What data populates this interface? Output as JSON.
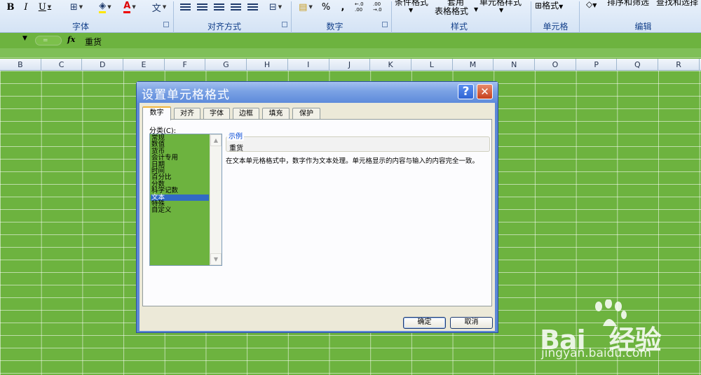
{
  "ribbon": {
    "groups": [
      "字体",
      "对齐方式",
      "数字",
      "样式",
      "单元格",
      "编辑"
    ],
    "text": {
      "cond_fmt": "条件格式",
      "table_fmt_top": "套用",
      "table_fmt": "表格格式",
      "cell_style": "单元格样式",
      "format": "格式",
      "sort": "排序和筛选",
      "find": "查找和选择"
    },
    "symbols": {
      "bold": "B",
      "italic": "I",
      "underline": "U",
      "font_color": "A",
      "wen": "文",
      "percent": "%",
      "comma": ",",
      "dec_inc": "←.0 .00",
      "dec_dec": ".00 →.0"
    }
  },
  "formula_bar": {
    "fx": "fx",
    "value": "重货"
  },
  "columns": [
    "B",
    "C",
    "D",
    "E",
    "F",
    "G",
    "H",
    "I",
    "J",
    "K",
    "L",
    "M",
    "N",
    "O",
    "P",
    "Q",
    "R"
  ],
  "dialog": {
    "title": "设置单元格格式",
    "help": "?",
    "close": "✕",
    "tabs": [
      "数字",
      "对齐",
      "字体",
      "边框",
      "填充",
      "保护"
    ],
    "category_label": "分类(C):",
    "categories": [
      "常规",
      "数值",
      "货币",
      "会计专用",
      "日期",
      "时间",
      "百分比",
      "分数",
      "科学记数",
      "文本",
      "特殊",
      "自定义"
    ],
    "selected_category": "文本",
    "sample_label": "示例",
    "sample_value": "重货",
    "description": "在文本单元格格式中，数字作为文本处理。单元格显示的内容与输入的内容完全一致。",
    "ok": "确定",
    "cancel": "取消"
  },
  "watermark": {
    "brand": "Bai",
    "brand_cn": "经验",
    "url": "jingyan.baidu.com"
  }
}
